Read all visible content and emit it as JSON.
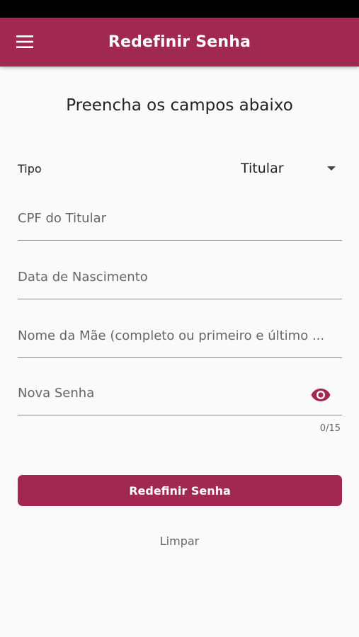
{
  "app_bar": {
    "title": "Redefinir Senha",
    "menu_icon": "hamburger-menu-icon"
  },
  "form": {
    "heading": "Preencha os campos abaixo",
    "tipo_label": "Tipo",
    "tipo_value": "Titular",
    "fields": [
      {
        "label": "CPF do Titular"
      },
      {
        "label": "Data de Nascimento"
      },
      {
        "label": "Nome da Mãe (completo ou primeiro e último ..."
      },
      {
        "label": "Nova Senha",
        "counter": "0/15",
        "visibility_icon": "eye-icon"
      }
    ],
    "submit_label": "Redefinir Senha",
    "clear_label": "Limpar"
  },
  "colors": {
    "primary": "#a12850",
    "background": "#fafafa",
    "status_bar": "#000000"
  }
}
